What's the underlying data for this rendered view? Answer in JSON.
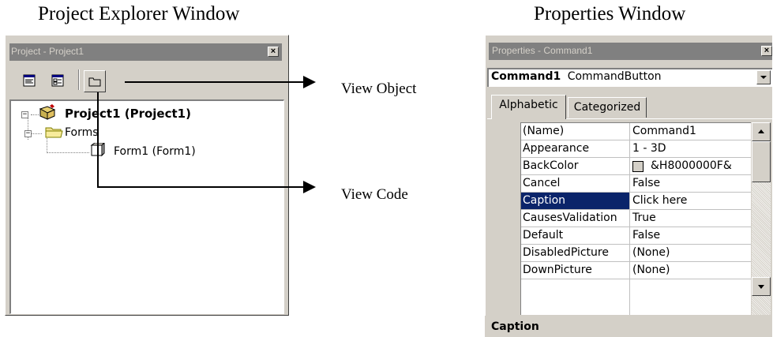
{
  "headings": {
    "project_explorer": "Project Explorer Window",
    "properties": "Properties Window"
  },
  "callouts": {
    "view_object": "View Object",
    "view_code": "View Code"
  },
  "project_explorer": {
    "title": "Project - Project1",
    "close_glyph": "×",
    "toolbar": [
      "view-code-icon",
      "view-object-icon",
      "toggle-folders-icon"
    ],
    "tree": {
      "project": "Project1 (Project1)",
      "folder": "Forms",
      "form": "Form1 (Form1)",
      "expand_glyph": "−"
    }
  },
  "properties_window": {
    "title": "Properties - Command1",
    "close_glyph": "×",
    "object_name": "Command1",
    "object_type": "CommandButton",
    "tabs": [
      "Alphabetic",
      "Categorized"
    ],
    "active_tab": "Alphabetic",
    "rows": [
      {
        "name": "(Name)",
        "value": "Command1"
      },
      {
        "name": "Appearance",
        "value": "1 - 3D"
      },
      {
        "name": "BackColor",
        "value": "&H8000000F&"
      },
      {
        "name": "Cancel",
        "value": "False"
      },
      {
        "name": "Caption",
        "value": "Click here"
      },
      {
        "name": "CausesValidation",
        "value": "True"
      },
      {
        "name": "Default",
        "value": "False"
      },
      {
        "name": "DisabledPicture",
        "value": "(None)"
      },
      {
        "name": "DownPicture",
        "value": "(None)"
      }
    ],
    "selected_row": "Caption",
    "description_title": "Caption",
    "colors": {
      "selection": "#0a246a",
      "title_bar": "#808080",
      "face": "#d4d0c8"
    }
  }
}
